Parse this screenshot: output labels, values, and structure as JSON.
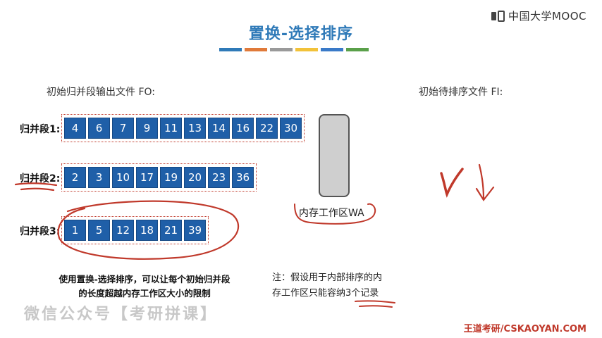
{
  "logo": {
    "text": "中国大学MOOC"
  },
  "title": "置换-选择排序",
  "colorbar": [
    "#2f7ab8",
    "#e07a3a",
    "#9a9a9a",
    "#f2c23a",
    "#3a7ac8",
    "#5aa04a"
  ],
  "labels": {
    "output_file": "初始归并段输出文件 FO:",
    "input_file": "初始待排序文件 FI:",
    "work_area": "内存工作区WA"
  },
  "runs": [
    {
      "label": "归并段1:",
      "values": [
        "4",
        "6",
        "7",
        "9",
        "11",
        "13",
        "14",
        "16",
        "22",
        "30"
      ]
    },
    {
      "label": "归并段2:",
      "values": [
        "2",
        "3",
        "10",
        "17",
        "19",
        "20",
        "23",
        "36"
      ]
    },
    {
      "label": "归并段3:",
      "values": [
        "1",
        "5",
        "12",
        "18",
        "21",
        "39"
      ]
    }
  ],
  "notes": {
    "left_line1": "使用置换-选择排序，可以让每个初始归并段",
    "left_line2": "的长度超越内存工作区大小的限制",
    "right_line1": "注：假设用于内部排序的内",
    "right_line2": "存工作区只能容纳3个记录"
  },
  "watermark": "微信公众号【考研拼课】",
  "footer": "王道考研/CSKAOYAN.COM",
  "colors": {
    "accent": "#2f7ab8",
    "cell": "#1f5fa8",
    "ink": "#c0392b"
  }
}
